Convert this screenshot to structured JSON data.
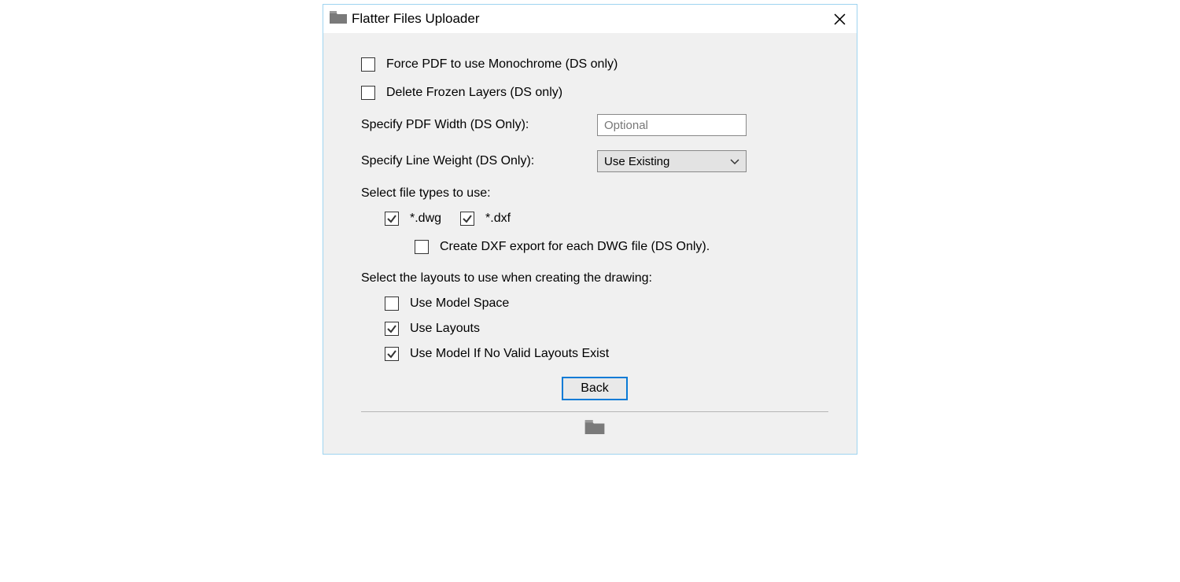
{
  "window": {
    "title": "Flatter Files Uploader"
  },
  "options": {
    "force_monochrome": {
      "label": "Force PDF to use Monochrome (DS only)",
      "checked": false
    },
    "delete_frozen": {
      "label": "Delete Frozen Layers (DS only)",
      "checked": false
    },
    "pdf_width_label": "Specify PDF Width (DS Only):",
    "pdf_width_placeholder": "Optional",
    "line_weight_label": "Specify Line Weight (DS Only):",
    "line_weight_value": "Use Existing",
    "filetypes_label": "Select file types to use:",
    "filetype_dwg": {
      "label": "*.dwg",
      "checked": true
    },
    "filetype_dxf": {
      "label": "*.dxf",
      "checked": true
    },
    "create_dxf_export": {
      "label": "Create DXF export for each DWG file (DS Only).",
      "checked": false
    },
    "layouts_label": "Select the layouts to use when creating the drawing:",
    "use_model_space": {
      "label": "Use Model Space",
      "checked": false
    },
    "use_layouts": {
      "label": "Use Layouts",
      "checked": true
    },
    "use_model_if_none": {
      "label": "Use Model If No Valid Layouts Exist",
      "checked": true
    }
  },
  "buttons": {
    "back": "Back"
  }
}
